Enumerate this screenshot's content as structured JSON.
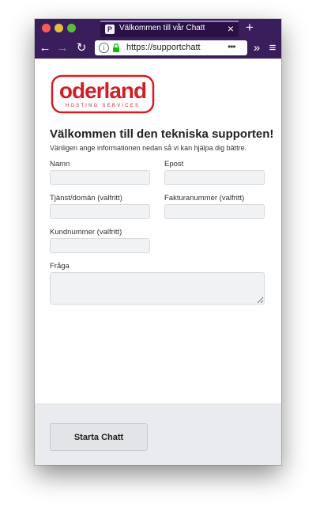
{
  "browser": {
    "tab_title": "Välkommen till vår Chatt",
    "tab_favicon": "P",
    "url": "https://supportchatt",
    "colors": {
      "chrome": "#3a1e5c",
      "tab": "#2a1145"
    }
  },
  "logo": {
    "text": "oderland",
    "tagline": "HOSTING SERVICES",
    "color": "#d11f25"
  },
  "page": {
    "heading": "Välkommen till den tekniska supporten!",
    "subheading": "Vänligen ange informationen nedan så vi kan hjälpa dig bättre."
  },
  "form": {
    "name_label": "Namn",
    "email_label": "Epost",
    "service_label": "Tjänst/domän (valfritt)",
    "invoice_label": "Fakturanummer (valfritt)",
    "customer_label": "Kundnummer (valfritt)",
    "question_label": "Fråga",
    "name_value": "",
    "email_value": "",
    "service_value": "",
    "invoice_value": "",
    "customer_value": "",
    "question_value": ""
  },
  "footer": {
    "start_button": "Starta Chatt"
  }
}
